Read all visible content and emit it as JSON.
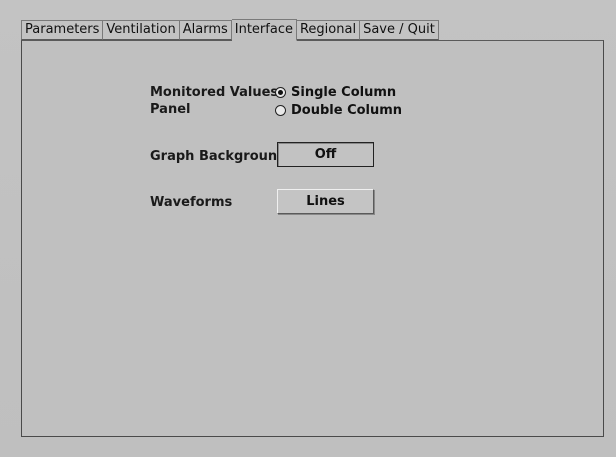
{
  "tabs": [
    {
      "label": "Parameters",
      "active": false
    },
    {
      "label": "Ventilation",
      "active": false
    },
    {
      "label": "Alarms",
      "active": false
    },
    {
      "label": "Interface",
      "active": true
    },
    {
      "label": "Regional",
      "active": false
    },
    {
      "label": "Save / Quit",
      "active": false
    }
  ],
  "settings": {
    "monitored_values": {
      "label_line1": "Monitored Values",
      "label_line2": "Panel",
      "options": [
        {
          "label": "Single Column",
          "selected": true
        },
        {
          "label": "Double Column",
          "selected": false
        }
      ]
    },
    "graph_background": {
      "label": "Graph Background",
      "value": "Off"
    },
    "waveforms": {
      "label": "Waveforms",
      "value": "Lines"
    }
  }
}
